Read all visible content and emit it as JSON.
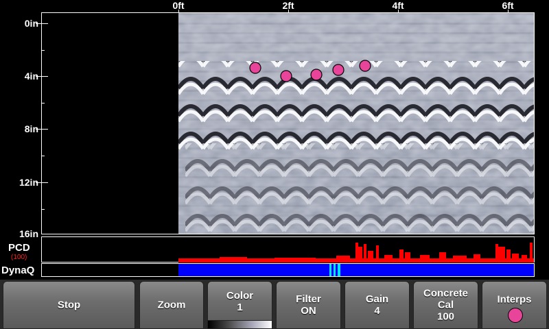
{
  "x_axis": {
    "ticks": [
      "0ft",
      "2ft",
      "4ft",
      "6ft"
    ]
  },
  "y_axis": {
    "ticks": [
      "0in",
      "4in",
      "8in",
      "12in",
      "16in"
    ]
  },
  "scan": {
    "target_markers": 5,
    "marker_color": "#e8459a"
  },
  "pcd": {
    "label": "PCD",
    "value": "(100)",
    "value_color": "#ff2020",
    "bar_color": "#ff0000"
  },
  "dynaq": {
    "label": "DynaQ",
    "bar_color": "#0000ff",
    "highlight_color": "#00e5ff"
  },
  "toolbar": {
    "stop": "Stop",
    "zoom": "Zoom",
    "color": {
      "label": "Color",
      "value": "1"
    },
    "filter": {
      "label": "Filter",
      "value": "ON"
    },
    "gain": {
      "label": "Gain",
      "value": "4"
    },
    "concrete_cal": {
      "label_line1": "Concrete",
      "label_line2": "Cal",
      "value": "100"
    },
    "interps": {
      "label": "Interps"
    }
  }
}
